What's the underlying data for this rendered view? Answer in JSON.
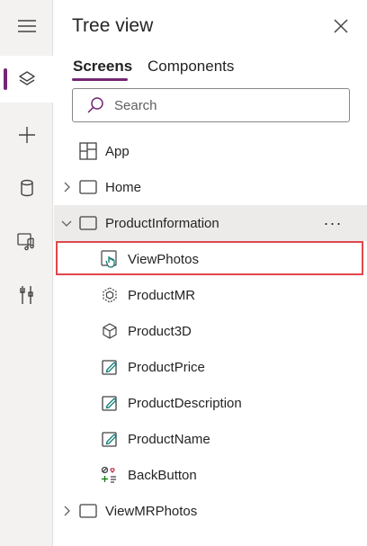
{
  "panel": {
    "title": "Tree view",
    "tabs": [
      {
        "label": "Screens",
        "active": true
      },
      {
        "label": "Components",
        "active": false
      }
    ],
    "search": {
      "placeholder": "Search",
      "value": ""
    },
    "accent_color": "#742774",
    "highlight_color": "#e0474c"
  },
  "rail": {
    "items": [
      {
        "name": "hamburger-menu-icon",
        "active": false
      },
      {
        "name": "layers-icon",
        "active": true
      },
      {
        "name": "add-icon",
        "active": false
      },
      {
        "name": "data-cylinder-icon",
        "active": false
      },
      {
        "name": "media-icon",
        "active": false
      },
      {
        "name": "tools-icon",
        "active": false
      }
    ]
  },
  "tree": {
    "app": {
      "label": "App"
    },
    "home": {
      "label": "Home"
    },
    "product_information": {
      "label": "ProductInformation",
      "more": "···"
    },
    "children": [
      {
        "label": "ViewPhotos",
        "icon": "image-control-icon"
      },
      {
        "label": "ProductMR",
        "icon": "mixed-reality-icon"
      },
      {
        "label": "Product3D",
        "icon": "cube-3d-icon"
      },
      {
        "label": "ProductPrice",
        "icon": "text-input-icon"
      },
      {
        "label": "ProductDescription",
        "icon": "text-input-icon"
      },
      {
        "label": "ProductName",
        "icon": "text-input-icon"
      },
      {
        "label": "BackButton",
        "icon": "button-control-icon"
      }
    ],
    "view_mr_photos": {
      "label": "ViewMRPhotos"
    }
  }
}
